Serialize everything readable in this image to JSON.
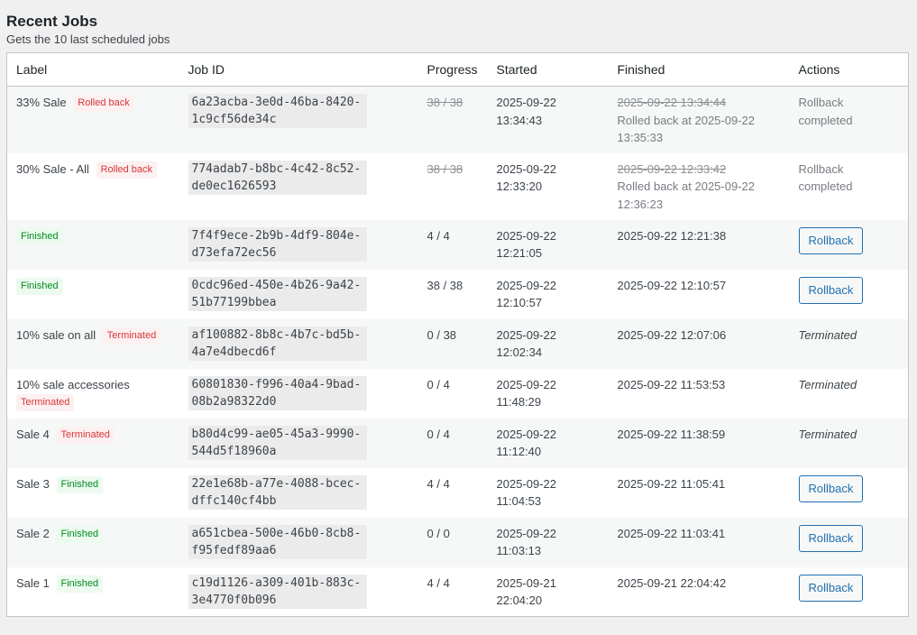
{
  "header": {
    "title": "Recent Jobs",
    "subtitle": "Gets the 10 last scheduled jobs"
  },
  "columns": {
    "label": "Label",
    "job_id": "Job ID",
    "progress": "Progress",
    "started": "Started",
    "finished": "Finished",
    "actions": "Actions"
  },
  "rows": [
    {
      "label": "33% Sale",
      "badge": "Rolled back",
      "job_id": "6a23acba-3e0d-46ba-8420-1c9cf56de34c",
      "progress": "38 / 38",
      "started": "2025-09-22 13:34:43",
      "finished": "2025-09-22 13:34:44",
      "finished_note": "Rolled back at 2025-09-22 13:35:33",
      "action": "Rollback completed"
    },
    {
      "label": "30% Sale - All",
      "badge": "Rolled back",
      "job_id": "774adab7-b8bc-4c42-8c52-de0ec1626593",
      "progress": "38 / 38",
      "started": "2025-09-22 12:33:20",
      "finished": "2025-09-22 12:33:42",
      "finished_note": "Rolled back at 2025-09-22 12:36:23",
      "action": "Rollback completed"
    },
    {
      "label": "",
      "badge": "Finished",
      "job_id": "7f4f9ece-2b9b-4df9-804e-d73efa72ec56",
      "progress": "4 / 4",
      "started": "2025-09-22 12:21:05",
      "finished": "2025-09-22 12:21:38",
      "action": "Rollback"
    },
    {
      "label": "",
      "badge": "Finished",
      "job_id": "0cdc96ed-450e-4b26-9a42-51b77199bbea",
      "progress": "38 / 38",
      "started": "2025-09-22 12:10:57",
      "finished": "2025-09-22 12:10:57",
      "action": "Rollback"
    },
    {
      "label": "10% sale on all",
      "badge": "Terminated",
      "job_id": "af100882-8b8c-4b7c-bd5b-4a7e4dbecd6f",
      "progress": "0 / 38",
      "started": "2025-09-22 12:02:34",
      "finished": "2025-09-22 12:07:06",
      "action": "Terminated"
    },
    {
      "label": "10% sale accessories",
      "badge": "Terminated",
      "job_id": "60801830-f996-40a4-9bad-08b2a98322d0",
      "progress": "0 / 4",
      "started": "2025-09-22 11:48:29",
      "finished": "2025-09-22 11:53:53",
      "action": "Terminated"
    },
    {
      "label": "Sale 4",
      "badge": "Terminated",
      "job_id": "b80d4c99-ae05-45a3-9990-544d5f18960a",
      "progress": "0 / 4",
      "started": "2025-09-22 11:12:40",
      "finished": "2025-09-22 11:38:59",
      "action": "Terminated"
    },
    {
      "label": "Sale 3",
      "badge": "Finished",
      "job_id": "22e1e68b-a77e-4088-bcec-dffc140cf4bb",
      "progress": "4 / 4",
      "started": "2025-09-22 11:04:53",
      "finished": "2025-09-22 11:05:41",
      "action": "Rollback"
    },
    {
      "label": "Sale 2",
      "badge": "Finished",
      "job_id": "a651cbea-500e-46b0-8cb8-f95fedf89aa6",
      "progress": "0 / 0",
      "started": "2025-09-22 11:03:13",
      "finished": "2025-09-22 11:03:41",
      "action": "Rollback"
    },
    {
      "label": "Sale 1",
      "badge": "Finished",
      "job_id": "c19d1126-a309-401b-883c-3e4770f0b096",
      "progress": "4 / 4",
      "started": "2025-09-21 22:04:20",
      "finished": "2025-09-21 22:04:42",
      "action": "Rollback"
    }
  ]
}
